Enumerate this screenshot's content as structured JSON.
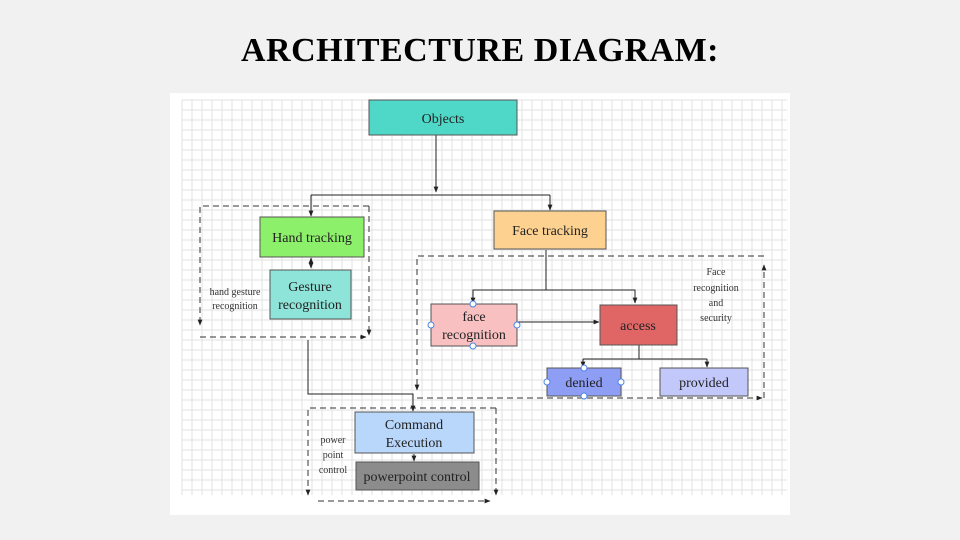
{
  "title": "ARCHITECTURE DIAGRAM:",
  "nodes": {
    "objects": "Objects",
    "hand_tracking": "Hand tracking",
    "gesture_recognition": [
      "Gesture",
      "recognition"
    ],
    "face_tracking": "Face tracking",
    "face_recognition": [
      "face",
      "recognition"
    ],
    "access": "access",
    "denied": "denied",
    "provided": "provided",
    "command_execution": [
      "Command",
      "Execution"
    ],
    "powerpoint_control": "powerpoint control"
  },
  "group_labels": {
    "hand_gesture": [
      "hand gesture",
      "recognition"
    ],
    "face_security": [
      "Face",
      "recognition",
      "and",
      "security"
    ],
    "powerpoint": [
      "power",
      "point",
      "control"
    ]
  },
  "colors": {
    "objects": "#4fd8c8",
    "hand_tracking": "#8df06a",
    "gesture_recognition": "#8ee4d8",
    "face_tracking": "#fdd291",
    "face_recognition": "#f8c0c0",
    "access": "#e06666",
    "denied": "#8e9ef5",
    "provided": "#c2c8fa",
    "command_execution": "#b9d6fb",
    "powerpoint_control": "#8c8c8c"
  }
}
